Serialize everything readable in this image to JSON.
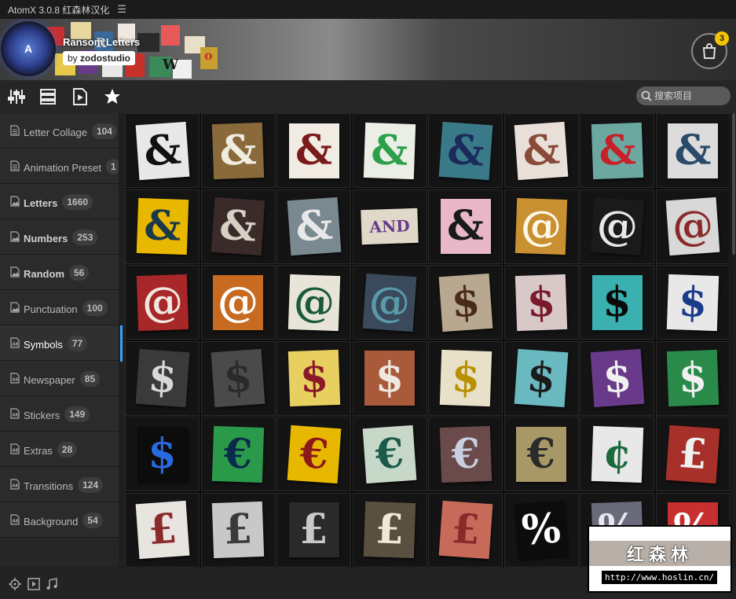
{
  "titlebar": {
    "title": "AtomX 3.0.8 红森林汉化",
    "menu_icon": "hamburger-icon"
  },
  "banner": {
    "title": "Ransom Letters",
    "author_prefix": "by",
    "author": "zodostudio",
    "logo_letter": "A",
    "cart_count": "3"
  },
  "search": {
    "placeholder": "搜索项目"
  },
  "categories": [
    {
      "name": "Letter Collage",
      "count": "104",
      "icon": "document-icon",
      "bold": false
    },
    {
      "name": "Animation Preset",
      "count": "1",
      "icon": "document-icon",
      "bold": false
    },
    {
      "name": "Letters",
      "count": "1660",
      "icon": "image-icon",
      "bold": true
    },
    {
      "name": "Numbers",
      "count": "253",
      "icon": "image-icon",
      "bold": true
    },
    {
      "name": "Random",
      "count": "56",
      "icon": "image-icon",
      "bold": true
    },
    {
      "name": "Punctuation",
      "count": "100",
      "icon": "image-icon",
      "bold": false
    },
    {
      "name": "Symbols",
      "count": "77",
      "icon": "ae-file-icon",
      "bold": false,
      "active": true
    },
    {
      "name": "Newspaper",
      "count": "85",
      "icon": "ae-file-icon",
      "bold": false
    },
    {
      "name": "Stickers",
      "count": "149",
      "icon": "ae-file-icon",
      "bold": false
    },
    {
      "name": "Extras",
      "count": "28",
      "icon": "ae-file-icon",
      "bold": false
    },
    {
      "name": "Transitions",
      "count": "124",
      "icon": "ae-file-icon",
      "bold": false
    },
    {
      "name": "Background",
      "count": "54",
      "icon": "ae-file-icon",
      "bold": false
    }
  ],
  "grid": [
    [
      {
        "c": "&",
        "bg": "#e8e8e8",
        "fg": "#111"
      },
      {
        "c": "&",
        "bg": "#8a6a3a",
        "fg": "#f0ece0"
      },
      {
        "c": "&",
        "bg": "#f0ece4",
        "fg": "#7a1a1a"
      },
      {
        "c": "&",
        "bg": "#eaeee4",
        "fg": "#2aa04a"
      },
      {
        "c": "&",
        "bg": "#3a7a88",
        "fg": "#1a2a5a"
      },
      {
        "c": "&",
        "bg": "#e8e0d8",
        "fg": "#8a4a3a"
      },
      {
        "c": "&",
        "bg": "#6aa8a0",
        "fg": "#c8202a"
      },
      {
        "c": "&",
        "bg": "#dcdcdc",
        "fg": "#2a4a6a"
      }
    ],
    [
      {
        "c": "&",
        "bg": "#e8b800",
        "fg": "#1a3a4a"
      },
      {
        "c": "&",
        "bg": "#3a2a2a",
        "fg": "#d8d0c4"
      },
      {
        "c": "&",
        "bg": "#7a8890",
        "fg": "#e8e8e8"
      },
      {
        "c": "AND",
        "bg": "#e0d8c8",
        "fg": "#6a3a8a"
      },
      {
        "c": "&",
        "bg": "#e8b8c8",
        "fg": "#1a1a1a"
      },
      {
        "c": "@",
        "bg": "#c89030",
        "fg": "#fff8e8"
      },
      {
        "c": "@",
        "bg": "#1a1a1a",
        "fg": "#e8e8e8"
      },
      {
        "c": "@",
        "bg": "#d8d8d8",
        "fg": "#8a2a2a"
      }
    ],
    [
      {
        "c": "@",
        "bg": "#a8282a",
        "fg": "#f0e8e0"
      },
      {
        "c": "@",
        "bg": "#c86a20",
        "fg": "#fff"
      },
      {
        "c": "@",
        "bg": "#e8e4d8",
        "fg": "#1a5a3a"
      },
      {
        "c": "@",
        "bg": "#3a4a5a",
        "fg": "#5a9aaa"
      },
      {
        "c": "$",
        "bg": "#b8a890",
        "fg": "#4a2a1a"
      },
      {
        "c": "$",
        "bg": "#d8c8c8",
        "fg": "#7a1a2a"
      },
      {
        "c": "$",
        "bg": "#3ab0b0",
        "fg": "#0a0a0a"
      },
      {
        "c": "$",
        "bg": "#e8e8e8",
        "fg": "#1a3a8a"
      }
    ],
    [
      {
        "c": "$",
        "bg": "#3a3a3a",
        "fg": "#d8d8d8"
      },
      {
        "c": "$",
        "bg": "#4a4a4a",
        "fg": "#2a2a2a"
      },
      {
        "c": "$",
        "bg": "#e8d060",
        "fg": "#8a1a2a"
      },
      {
        "c": "$",
        "bg": "#a85a3a",
        "fg": "#f0e8e0"
      },
      {
        "c": "$",
        "bg": "#e8e0c8",
        "fg": "#b89000"
      },
      {
        "c": "$",
        "bg": "#6ab8c0",
        "fg": "#1a1a1a"
      },
      {
        "c": "$",
        "bg": "#6a3a8a",
        "fg": "#f0f0f0"
      },
      {
        "c": "$",
        "bg": "#2a8a4a",
        "fg": "#f0f0f0"
      }
    ],
    [
      {
        "c": "$",
        "bg": "#0c0c0c",
        "fg": "#2a6ae0"
      },
      {
        "c": "€",
        "bg": "#2a9a4a",
        "fg": "#0a2a4a"
      },
      {
        "c": "€",
        "bg": "#e8b800",
        "fg": "#8a1a1a"
      },
      {
        "c": "€",
        "bg": "#c8d8c8",
        "fg": "#1a5a4a"
      },
      {
        "c": "€",
        "bg": "#6a4a4a",
        "fg": "#c8d0e0"
      },
      {
        "c": "€",
        "bg": "#a89868",
        "fg": "#2a2a2a"
      },
      {
        "c": "¢",
        "bg": "#e8e8e8",
        "fg": "#1a6a3a"
      },
      {
        "c": "£",
        "bg": "#a8302a",
        "fg": "#f0f0f0"
      }
    ],
    [
      {
        "c": "£",
        "bg": "#e8e4e0",
        "fg": "#8a2a2a"
      },
      {
        "c": "£",
        "bg": "#c8c8c8",
        "fg": "#3a3a3a"
      },
      {
        "c": "£",
        "bg": "#2a2a2a",
        "fg": "#c8c8c8"
      },
      {
        "c": "£",
        "bg": "#5a5040",
        "fg": "#f0e8d8"
      },
      {
        "c": "£",
        "bg": "#c86a5a",
        "fg": "#8a2a2a"
      },
      {
        "c": "%",
        "bg": "#0c0c0c",
        "fg": "#ffffff"
      },
      {
        "c": "%",
        "bg": "#6a6a7a",
        "fg": "#e8e8f0"
      },
      {
        "c": "%",
        "bg": "#c83030",
        "fg": "#ffffff"
      }
    ]
  ],
  "bottombar": {
    "icons": [
      "target-icon",
      "play-box-icon",
      "music-note-icon"
    ]
  },
  "watermark": {
    "title": "红森林",
    "url": "http://www.hoslin.cn/"
  }
}
